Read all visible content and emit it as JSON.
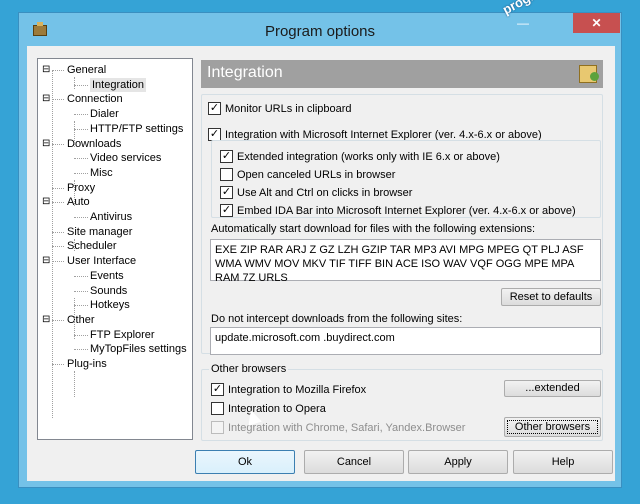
{
  "window": {
    "title": "Program options",
    "minimize": "—",
    "close": "✕"
  },
  "watermark": "programecalculator.ro",
  "tree": [
    {
      "label": "General",
      "toggle": "⊟",
      "level": 0
    },
    {
      "label": "Integration",
      "level": 1,
      "selected": true
    },
    {
      "label": "Connection",
      "toggle": "⊟",
      "level": 0
    },
    {
      "label": "Dialer",
      "level": 1
    },
    {
      "label": "HTTP/FTP settings",
      "level": 1
    },
    {
      "label": "Downloads",
      "toggle": "⊟",
      "level": 0
    },
    {
      "label": "Video services",
      "level": 1
    },
    {
      "label": "Misc",
      "level": 1
    },
    {
      "label": "Proxy",
      "level": 0
    },
    {
      "label": "Auto",
      "toggle": "⊟",
      "level": 0
    },
    {
      "label": "Antivirus",
      "level": 1
    },
    {
      "label": "Site manager",
      "level": 0
    },
    {
      "label": "Scheduler",
      "level": 0
    },
    {
      "label": "User Interface",
      "toggle": "⊟",
      "level": 0
    },
    {
      "label": "Events",
      "level": 1
    },
    {
      "label": "Sounds",
      "level": 1
    },
    {
      "label": "Hotkeys",
      "level": 1
    },
    {
      "label": "Other",
      "toggle": "⊟",
      "level": 0
    },
    {
      "label": "FTP Explorer",
      "level": 1
    },
    {
      "label": "MyTopFiles settings",
      "level": 1
    },
    {
      "label": "Plug-ins",
      "level": 0
    }
  ],
  "panel": {
    "title": "Integration",
    "monitor_urls": {
      "label": "Monitor URLs in clipboard",
      "checked": true
    },
    "ie_integration": {
      "label": "Integration with Microsoft Internet Explorer (ver. 4.x-6.x or above)",
      "checked": true
    },
    "extended_integration": {
      "label": "Extended integration (works only with IE 6.x or above)",
      "checked": true
    },
    "open_canceled": {
      "label": "Open canceled URLs in browser",
      "checked": false
    },
    "alt_ctrl": {
      "label": "Use Alt and Ctrl on clicks in browser",
      "checked": true
    },
    "embed_bar": {
      "label": "Embed IDA Bar into Microsoft Internet Explorer (ver. 4.x-6.x or above)",
      "checked": true
    },
    "extensions_label": "Automatically start download for files with the following extensions:",
    "extensions_value": "EXE ZIP RAR ARJ Z GZ LZH GZIP TAR MP3 AVI MPG MPEG QT PLJ ASF WMA WMV MOV MKV TIF TIFF BIN ACE ISO WAV VQF OGG MPE MPA RAM 7Z URLS",
    "reset_defaults": "Reset to defaults",
    "no_intercept_label": "Do not intercept downloads from the following sites:",
    "no_intercept_value": "update.microsoft.com .buydirect.com",
    "other_browsers": {
      "group_label": "Other browsers",
      "firefox": {
        "label": "Integration to Mozilla Firefox",
        "checked": true
      },
      "opera": {
        "label": "Integration to Opera",
        "checked": false
      },
      "chrome": {
        "label": "Integration with Chrome, Safari, Yandex.Browser",
        "checked": false,
        "disabled": true
      },
      "extended_button": "...extended",
      "other_button": "Other browsers"
    }
  },
  "buttons": {
    "ok": "Ok",
    "cancel": "Cancel",
    "apply": "Apply",
    "help": "Help"
  },
  "check_glyph": "✓"
}
